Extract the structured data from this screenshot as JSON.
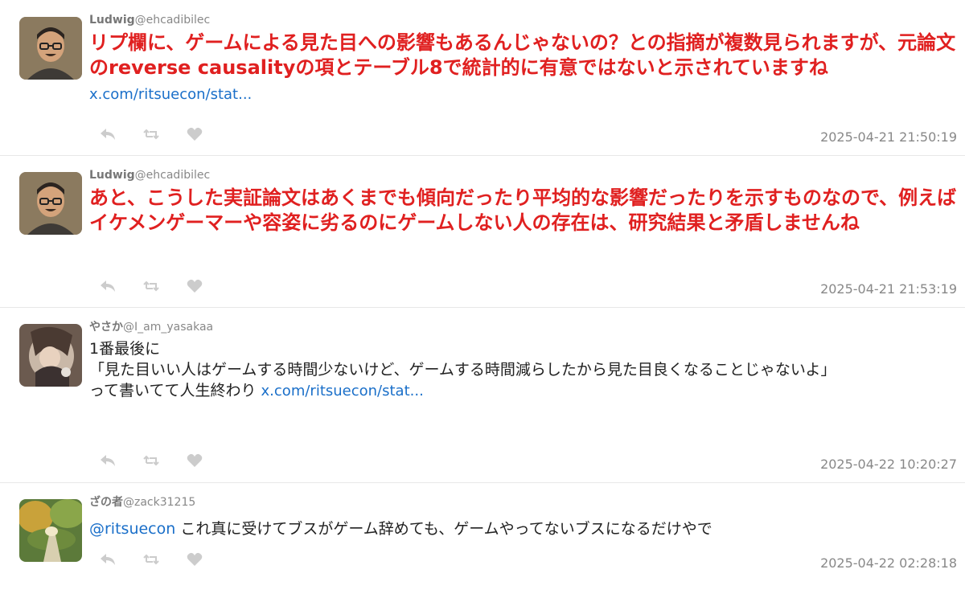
{
  "tweets": [
    {
      "name": "Ludwig",
      "handle": "@ehcadibilec",
      "text": "リプ欄に、ゲームによる見た目への影響もあるんじゃないの？との指摘が複数見られますが、元論文のreverse causalityの項とテーブル8で統計的に有意ではないと示されていますね",
      "link": "x.com/ritsuecon/stat...",
      "timestamp": "2025-04-21 21:50:19"
    },
    {
      "name": "Ludwig",
      "handle": "@ehcadibilec",
      "text": "あと、こうした実証論文はあくまでも傾向だったり平均的な影響だったりを示すものなので、例えばイケメンゲーマーや容姿に劣るのにゲームしない人の存在は、研究結果と矛盾しませんね",
      "timestamp": "2025-04-21 21:53:19"
    },
    {
      "name": "やさか",
      "handle": "@I_am_yasakaa",
      "lines": [
        "1番最後に",
        "「見た目いい人はゲームする時間少ないけど、ゲームする時間減らしたから見た目良くなることじゃないよ」",
        "って書いてて人生終わり"
      ],
      "link": "x.com/ritsuecon/stat...",
      "timestamp": "2025-04-22 10:20:27"
    },
    {
      "name": "ざの者",
      "handle": "@zack31215",
      "mention": "@ritsuecon",
      "text": " これ真に受けてブスがゲーム辞めても、ゲームやってないブスになるだけやで",
      "timestamp": "2025-04-22 02:28:18"
    }
  ],
  "icons": {
    "reply": "reply-icon",
    "retweet": "retweet-icon",
    "like": "heart-icon"
  },
  "colors": {
    "highlight_text": "#e02020",
    "link": "#1a6fc9",
    "meta": "#888888",
    "action_icon": "#cccccc"
  }
}
